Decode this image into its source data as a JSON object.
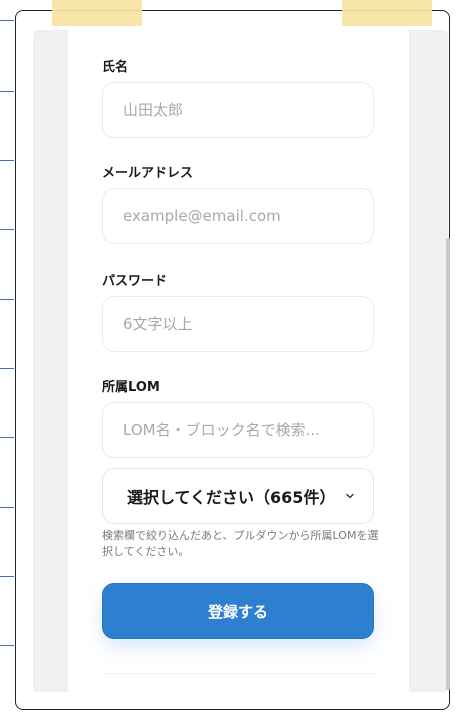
{
  "form": {
    "name": {
      "label": "氏名",
      "placeholder": "山田太郎",
      "value": ""
    },
    "email": {
      "label": "メールアドレス",
      "placeholder": "example@email.com",
      "value": ""
    },
    "password": {
      "label": "パスワード",
      "placeholder": "6文字以上",
      "value": ""
    },
    "lom": {
      "label": "所属LOM",
      "search_placeholder": "LOM名・ブロック名で検索...",
      "select_value": "選択してください（665件）",
      "hint": "検索欄で絞り込んだあと、プルダウンから所属LOMを選択してください。"
    },
    "submit_label": "登録する"
  },
  "colors": {
    "primary": "#2f7fd0",
    "tape": "#f6e3a2",
    "frame": "#1f2430",
    "panel": "#f0f0f0"
  },
  "icons": {
    "select_arrow": "chevron-down-icon"
  }
}
